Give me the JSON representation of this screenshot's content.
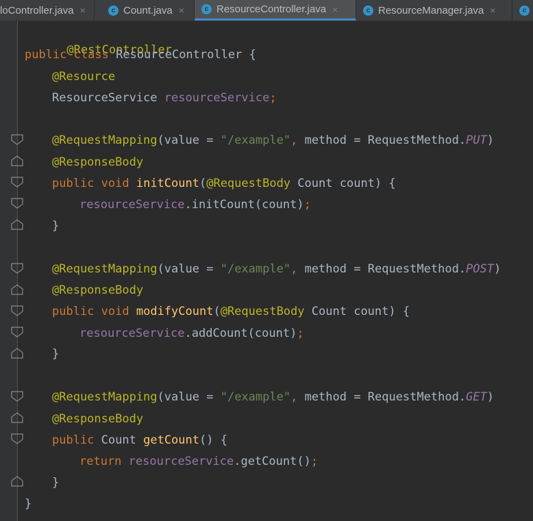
{
  "tabs": [
    {
      "label": "loController.java",
      "active": false,
      "icon": "class-icon"
    },
    {
      "label": "Count.java",
      "active": false,
      "icon": "class-icon"
    },
    {
      "label": "ResourceController.java",
      "active": true,
      "icon": "class-icon"
    },
    {
      "label": "ResourceManager.java",
      "active": false,
      "icon": "class-icon"
    }
  ],
  "tab_close_symbol": "×",
  "class_icon_letter": "c",
  "code": {
    "class_annotation": "@RestController",
    "class_kw": "public class",
    "class_name": "ResourceController",
    "brace_open": "{",
    "brace_close": "}",
    "field_annotation": "@Resource",
    "field_type": "ResourceService",
    "field_name": "resourceService",
    "semicolon": ";",
    "mapping_prefix": "@RequestMapping",
    "value_key": "value",
    "equals": "=",
    "path": "\"/example\"",
    "comma": ",",
    "method_key": "method",
    "request_method": "RequestMethod.",
    "response_body": "@ResponseBody",
    "request_body": "@RequestBody",
    "count_type": "Count",
    "count_param": "count",
    "public_void": "public void",
    "public_kw": "public",
    "return_kw": "return",
    "methods": [
      {
        "http": "PUT",
        "name": "initCount",
        "call": "initCount"
      },
      {
        "http": "POST",
        "name": "modifyCount",
        "call": "addCount"
      },
      {
        "http": "GET",
        "name": "getCount",
        "call": "getCount"
      }
    ]
  },
  "colors": {
    "background": "#2b2b2b",
    "annotation": "#bbb529",
    "keyword": "#cc7832",
    "field": "#9876aa",
    "string": "#6a8759",
    "method": "#ffc66d",
    "text": "#a9b7c6"
  }
}
